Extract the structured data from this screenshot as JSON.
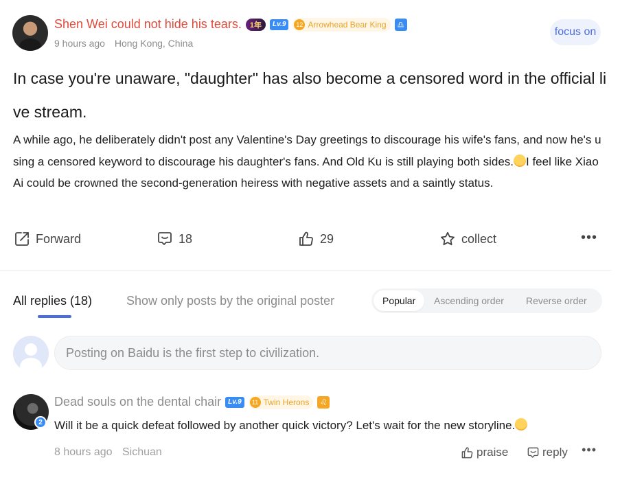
{
  "post": {
    "author": {
      "name": "Shen Wei could not hide his tears.",
      "year_badge": "1年",
      "level": "Lv.9",
      "fan_level": "12",
      "fan_title": "Arrowhead Bear King",
      "zodiac_glyph": "♎",
      "time": "9 hours ago",
      "location": "Hong Kong, China"
    },
    "focus_label": "focus on",
    "title": "In case you're unaware, \"daughter\" has also become a censored word in the official live stream.",
    "body_before_emoji": "A while ago, he deliberately didn't post any Valentine's Day greetings to discourage his wife's fans, and now he's using a censored keyword to discourage his daughter's fans. And Old Ku is still playing both sides.",
    "body_after_emoji": "I feel like Xiao Ai could be crowned the second-generation heiress with negative assets and a saintly status.",
    "actions": {
      "forward": "Forward",
      "comments": "18",
      "likes": "29",
      "collect": "collect",
      "more": "•••"
    }
  },
  "replies": {
    "tab_all": "All replies (18)",
    "tab_op": "Show only posts by the original poster",
    "sort": [
      "Popular",
      "Ascending order",
      "Reverse order"
    ],
    "input_placeholder": "Posting on Baidu is the first step to civilization."
  },
  "comment": {
    "avatar_level": "2",
    "name": "Dead souls on the dental chair",
    "level": "Lv.9",
    "fan_level": "11",
    "fan_title": "Twin Herons",
    "zodiac_glyph": "♌",
    "text": "Will it be a quick defeat followed by another quick victory? Let's wait for the new storyline.",
    "time": "8 hours ago",
    "location": "Sichuan",
    "praise": "praise",
    "reply": "reply",
    "more": "•••"
  },
  "colors": {
    "username_red": "#e04a3a",
    "accent_blue": "#4a6ee0",
    "level_blue": "#3a8cf5",
    "fan_gold": "#f5a623"
  }
}
